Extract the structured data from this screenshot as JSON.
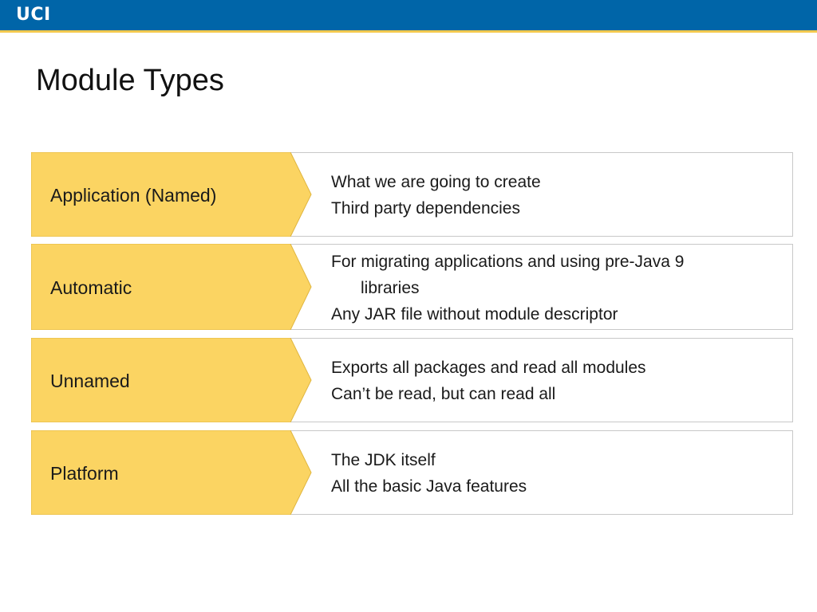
{
  "header": {
    "logo_text": "UCI",
    "bar_color": "#0065a8",
    "accent_color": "#f3c94f"
  },
  "slide": {
    "title": "Module Types"
  },
  "colors": {
    "chevron_fill": "#fbd462",
    "chevron_stroke": "#e0b640",
    "border": "#c8c8c8"
  },
  "rows": [
    {
      "label": "Application (Named)",
      "lines": [
        "What we are going to create",
        "Third party dependencies"
      ]
    },
    {
      "label": "Automatic",
      "lines": [
        "For migrating applications and using pre-Java 9",
        "libraries",
        "Any JAR file without module descriptor"
      ]
    },
    {
      "label": "Unnamed",
      "lines": [
        "Exports all packages and read all modules",
        "Can’t be read, but can read all"
      ]
    },
    {
      "label": "Platform",
      "lines": [
        "The JDK itself",
        "All the basic Java features"
      ]
    }
  ]
}
